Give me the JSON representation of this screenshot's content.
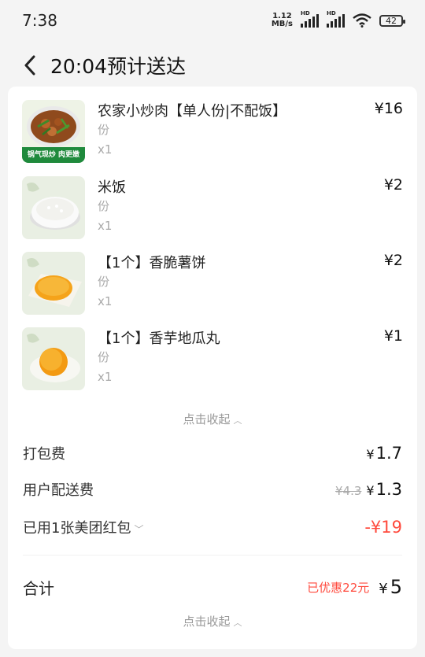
{
  "status_bar": {
    "time": "7:38",
    "net_speed_value": "1.12",
    "net_speed_unit": "MB/s",
    "hd1": "HD",
    "hd2": "HD",
    "battery": "42"
  },
  "header": {
    "title": "20:04预计送达"
  },
  "items": [
    {
      "name": "农家小炒肉【单人份|不配饭】",
      "unit": "份",
      "qty": "x1",
      "price": "¥16",
      "thumb_caption": "锅气现炒 肉更嫩"
    },
    {
      "name": "米饭",
      "unit": "份",
      "qty": "x1",
      "price": "¥2"
    },
    {
      "name": "【1个】香脆薯饼",
      "unit": "份",
      "qty": "x1",
      "price": "¥2"
    },
    {
      "name": "【1个】香芋地瓜丸",
      "unit": "份",
      "qty": "x1",
      "price": "¥1"
    }
  ],
  "collapse_label": "点击收起",
  "fees": {
    "packing_label": "打包费",
    "packing_value": "1.7",
    "delivery_label": "用户配送费",
    "delivery_original": "¥4.3",
    "delivery_value": "1.3",
    "coupon_label": "已用1张美团红包",
    "coupon_value": "-¥19"
  },
  "total": {
    "label": "合计",
    "discount": "已优惠22元",
    "value": "5"
  },
  "colors": {
    "accent_red": "#ff4a3d",
    "background": "#f4f4f4"
  }
}
